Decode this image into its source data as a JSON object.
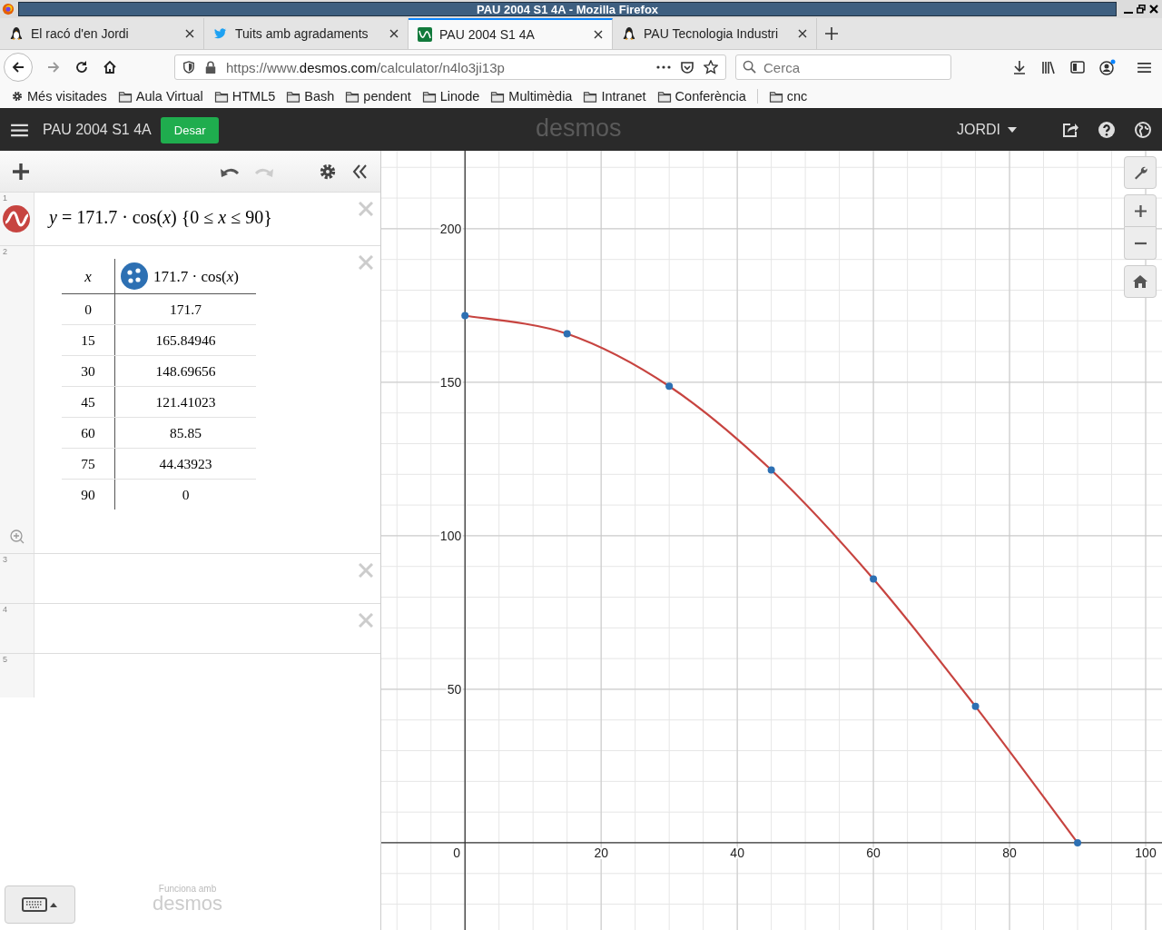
{
  "window": {
    "title": "PAU 2004 S1 4A - Mozilla Firefox"
  },
  "tabs": [
    {
      "label": "El racó d'en Jordi",
      "selected": false,
      "kind": "penguin"
    },
    {
      "label": "Tuits amb agradaments",
      "selected": false,
      "kind": "bird"
    },
    {
      "label": "PAU 2004 S1 4A",
      "selected": true,
      "kind": "graph"
    },
    {
      "label": "PAU Tecnologia Industri",
      "selected": false,
      "kind": "penguin"
    }
  ],
  "address": {
    "scheme": "https://www.",
    "domain": "desmos.com",
    "path": "/calculator/n4lo3ji13p"
  },
  "search": {
    "placeholder": "Cerca"
  },
  "bookmarks": [
    {
      "label": "Més visitades",
      "kind": "gear"
    },
    {
      "label": "Aula Virtual",
      "kind": "folder"
    },
    {
      "label": "HTML5",
      "kind": "folder"
    },
    {
      "label": "Bash",
      "kind": "folder"
    },
    {
      "label": "pendent",
      "kind": "folder"
    },
    {
      "label": "Linode",
      "kind": "folder"
    },
    {
      "label": "Multimèdia",
      "kind": "folder"
    },
    {
      "label": "Intranet",
      "kind": "folder"
    },
    {
      "label": "Conferència",
      "kind": "folder"
    },
    {
      "label": "cnc",
      "kind": "folder"
    }
  ],
  "app": {
    "title": "PAU 2004 S1 4A",
    "save_button": "Desar",
    "logo": "desmos",
    "user": "JORDI"
  },
  "expressions": [
    {
      "number": "1",
      "kind": "expression",
      "color": "#c74440",
      "deletable": true,
      "formula": "*y* = 171.7 · cos(*x*) {0 ≤ *x* ≤ 90}"
    },
    {
      "number": "2",
      "kind": "table",
      "color": "#2d70b3",
      "deletable": true,
      "columns": [
        "x",
        "171.7 · cos(*x*)"
      ],
      "rows": [
        [
          "0",
          "171.7"
        ],
        [
          "15",
          "165.84946"
        ],
        [
          "30",
          "148.69656"
        ],
        [
          "45",
          "121.41023"
        ],
        [
          "60",
          "85.85"
        ],
        [
          "75",
          "44.43923"
        ],
        [
          "90",
          "0"
        ]
      ]
    },
    {
      "number": "3",
      "kind": "empty",
      "deletable": true
    },
    {
      "number": "4",
      "kind": "empty",
      "deletable": true
    },
    {
      "number": "5",
      "kind": "empty"
    }
  ],
  "footer": {
    "label": "Funciona amb",
    "logo": "desmos"
  },
  "graph": {
    "chart_data": {
      "type": "line",
      "grid": true,
      "x": [
        0,
        15,
        30,
        45,
        60,
        75,
        90
      ],
      "xlim": [
        -12.3,
        102.4
      ],
      "ylim": [
        -29,
        225.4
      ],
      "xticks": [
        0,
        20,
        40,
        60,
        80,
        100
      ],
      "yticks": [
        50,
        100,
        150,
        200
      ],
      "series": [
        {
          "color": "#c74440",
          "marker": true,
          "values": [
            171.7,
            165.8,
            148.7,
            121.4,
            85.9,
            44.4,
            0
          ]
        }
      ]
    }
  }
}
